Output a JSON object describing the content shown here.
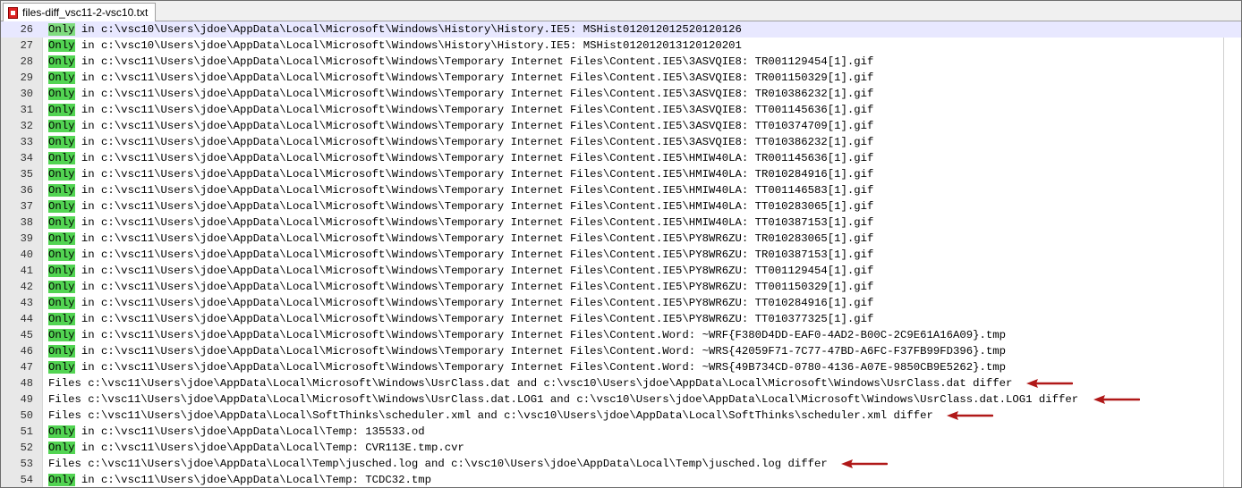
{
  "window": {
    "tab_title": "files-diff_vsc11-2-vsc10.txt",
    "tab_icon": "document-icon"
  },
  "colors": {
    "highlight": "#52d452",
    "arrow": "#b01818",
    "current_line": "#e8e8ff"
  },
  "lines": [
    {
      "num": "26",
      "kw": "Only",
      "rest": " in c:\\vsc10\\Users\\jdoe\\AppData\\Local\\Microsoft\\Windows\\History\\History.IE5: MSHist012012012520120126"
    },
    {
      "num": "27",
      "kw": "Only",
      "rest": " in c:\\vsc10\\Users\\jdoe\\AppData\\Local\\Microsoft\\Windows\\History\\History.IE5: MSHist012012013120120201"
    },
    {
      "num": "28",
      "kw": "Only",
      "rest": " in c:\\vsc11\\Users\\jdoe\\AppData\\Local\\Microsoft\\Windows\\Temporary Internet Files\\Content.IE5\\3ASVQIE8: TR001129454[1].gif"
    },
    {
      "num": "29",
      "kw": "Only",
      "rest": " in c:\\vsc11\\Users\\jdoe\\AppData\\Local\\Microsoft\\Windows\\Temporary Internet Files\\Content.IE5\\3ASVQIE8: TR001150329[1].gif"
    },
    {
      "num": "30",
      "kw": "Only",
      "rest": " in c:\\vsc11\\Users\\jdoe\\AppData\\Local\\Microsoft\\Windows\\Temporary Internet Files\\Content.IE5\\3ASVQIE8: TR010386232[1].gif"
    },
    {
      "num": "31",
      "kw": "Only",
      "rest": " in c:\\vsc11\\Users\\jdoe\\AppData\\Local\\Microsoft\\Windows\\Temporary Internet Files\\Content.IE5\\3ASVQIE8: TT001145636[1].gif"
    },
    {
      "num": "32",
      "kw": "Only",
      "rest": " in c:\\vsc11\\Users\\jdoe\\AppData\\Local\\Microsoft\\Windows\\Temporary Internet Files\\Content.IE5\\3ASVQIE8: TT010374709[1].gif"
    },
    {
      "num": "33",
      "kw": "Only",
      "rest": " in c:\\vsc11\\Users\\jdoe\\AppData\\Local\\Microsoft\\Windows\\Temporary Internet Files\\Content.IE5\\3ASVQIE8: TT010386232[1].gif"
    },
    {
      "num": "34",
      "kw": "Only",
      "rest": " in c:\\vsc11\\Users\\jdoe\\AppData\\Local\\Microsoft\\Windows\\Temporary Internet Files\\Content.IE5\\HMIW40LA: TR001145636[1].gif"
    },
    {
      "num": "35",
      "kw": "Only",
      "rest": " in c:\\vsc11\\Users\\jdoe\\AppData\\Local\\Microsoft\\Windows\\Temporary Internet Files\\Content.IE5\\HMIW40LA: TR010284916[1].gif"
    },
    {
      "num": "36",
      "kw": "Only",
      "rest": " in c:\\vsc11\\Users\\jdoe\\AppData\\Local\\Microsoft\\Windows\\Temporary Internet Files\\Content.IE5\\HMIW40LA: TT001146583[1].gif"
    },
    {
      "num": "37",
      "kw": "Only",
      "rest": " in c:\\vsc11\\Users\\jdoe\\AppData\\Local\\Microsoft\\Windows\\Temporary Internet Files\\Content.IE5\\HMIW40LA: TT010283065[1].gif"
    },
    {
      "num": "38",
      "kw": "Only",
      "rest": " in c:\\vsc11\\Users\\jdoe\\AppData\\Local\\Microsoft\\Windows\\Temporary Internet Files\\Content.IE5\\HMIW40LA: TT010387153[1].gif"
    },
    {
      "num": "39",
      "kw": "Only",
      "rest": " in c:\\vsc11\\Users\\jdoe\\AppData\\Local\\Microsoft\\Windows\\Temporary Internet Files\\Content.IE5\\PY8WR6ZU: TR010283065[1].gif"
    },
    {
      "num": "40",
      "kw": "Only",
      "rest": " in c:\\vsc11\\Users\\jdoe\\AppData\\Local\\Microsoft\\Windows\\Temporary Internet Files\\Content.IE5\\PY8WR6ZU: TR010387153[1].gif"
    },
    {
      "num": "41",
      "kw": "Only",
      "rest": " in c:\\vsc11\\Users\\jdoe\\AppData\\Local\\Microsoft\\Windows\\Temporary Internet Files\\Content.IE5\\PY8WR6ZU: TT001129454[1].gif"
    },
    {
      "num": "42",
      "kw": "Only",
      "rest": " in c:\\vsc11\\Users\\jdoe\\AppData\\Local\\Microsoft\\Windows\\Temporary Internet Files\\Content.IE5\\PY8WR6ZU: TT001150329[1].gif"
    },
    {
      "num": "43",
      "kw": "Only",
      "rest": " in c:\\vsc11\\Users\\jdoe\\AppData\\Local\\Microsoft\\Windows\\Temporary Internet Files\\Content.IE5\\PY8WR6ZU: TT010284916[1].gif"
    },
    {
      "num": "44",
      "kw": "Only",
      "rest": " in c:\\vsc11\\Users\\jdoe\\AppData\\Local\\Microsoft\\Windows\\Temporary Internet Files\\Content.IE5\\PY8WR6ZU: TT010377325[1].gif"
    },
    {
      "num": "45",
      "kw": "Only",
      "rest": " in c:\\vsc11\\Users\\jdoe\\AppData\\Local\\Microsoft\\Windows\\Temporary Internet Files\\Content.Word: ~WRF{F380D4DD-EAF0-4AD2-B00C-2C9E61A16A09}.tmp"
    },
    {
      "num": "46",
      "kw": "Only",
      "rest": " in c:\\vsc11\\Users\\jdoe\\AppData\\Local\\Microsoft\\Windows\\Temporary Internet Files\\Content.Word: ~WRS{42059F71-7C77-47BD-A6FC-F37FB99FD396}.tmp"
    },
    {
      "num": "47",
      "kw": "Only",
      "rest": " in c:\\vsc11\\Users\\jdoe\\AppData\\Local\\Microsoft\\Windows\\Temporary Internet Files\\Content.Word: ~WRS{49B734CD-0780-4136-A07E-9850CB9E5262}.tmp"
    },
    {
      "num": "48",
      "kw": "",
      "rest": "Files c:\\vsc11\\Users\\jdoe\\AppData\\Local\\Microsoft\\Windows\\UsrClass.dat and c:\\vsc10\\Users\\jdoe\\AppData\\Local\\Microsoft\\Windows\\UsrClass.dat differ",
      "arrow": true
    },
    {
      "num": "49",
      "kw": "",
      "rest": "Files c:\\vsc11\\Users\\jdoe\\AppData\\Local\\Microsoft\\Windows\\UsrClass.dat.LOG1 and c:\\vsc10\\Users\\jdoe\\AppData\\Local\\Microsoft\\Windows\\UsrClass.dat.LOG1 differ",
      "arrow": true
    },
    {
      "num": "50",
      "kw": "",
      "rest": "Files c:\\vsc11\\Users\\jdoe\\AppData\\Local\\SoftThinks\\scheduler.xml and c:\\vsc10\\Users\\jdoe\\AppData\\Local\\SoftThinks\\scheduler.xml differ",
      "arrow": true
    },
    {
      "num": "51",
      "kw": "Only",
      "rest": " in c:\\vsc11\\Users\\jdoe\\AppData\\Local\\Temp: 135533.od"
    },
    {
      "num": "52",
      "kw": "Only",
      "rest": " in c:\\vsc11\\Users\\jdoe\\AppData\\Local\\Temp: CVR113E.tmp.cvr"
    },
    {
      "num": "53",
      "kw": "",
      "rest": "Files c:\\vsc11\\Users\\jdoe\\AppData\\Local\\Temp\\jusched.log and c:\\vsc10\\Users\\jdoe\\AppData\\Local\\Temp\\jusched.log differ",
      "arrow": true
    },
    {
      "num": "54",
      "kw": "Only",
      "rest": " in c:\\vsc11\\Users\\jdoe\\AppData\\Local\\Temp: TCDC32.tmp"
    }
  ]
}
